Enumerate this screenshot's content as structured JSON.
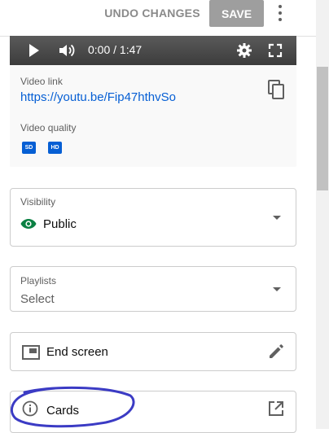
{
  "header": {
    "undo_label": "UNDO CHANGES",
    "save_label": "SAVE",
    "more_icon": "more-vert-icon"
  },
  "player": {
    "time": "0:00 / 1:47",
    "icons": [
      "play-icon",
      "volume-icon",
      "gear-icon",
      "fullscreen-icon"
    ]
  },
  "video": {
    "link_label": "Video link",
    "link_url": "https://youtu.be/Fip47hthvSo",
    "quality_label": "Video quality",
    "quality_badges": [
      "SD",
      "HD"
    ]
  },
  "visibility": {
    "label": "Visibility",
    "value": "Public",
    "icon": "eye-icon"
  },
  "playlists": {
    "label": "Playlists",
    "placeholder": "Select"
  },
  "end_screen": {
    "label": "End screen",
    "icon": "end-screen-icon",
    "action_icon": "pencil-icon"
  },
  "cards": {
    "label": "Cards",
    "icon": "info-icon",
    "action_icon": "open-external-icon"
  },
  "colors": {
    "link": "#065fd4",
    "save_button_bg": "#9e9e9e",
    "visibility_icon": "#0b8043",
    "annotation_ink": "#3b3bc4"
  }
}
